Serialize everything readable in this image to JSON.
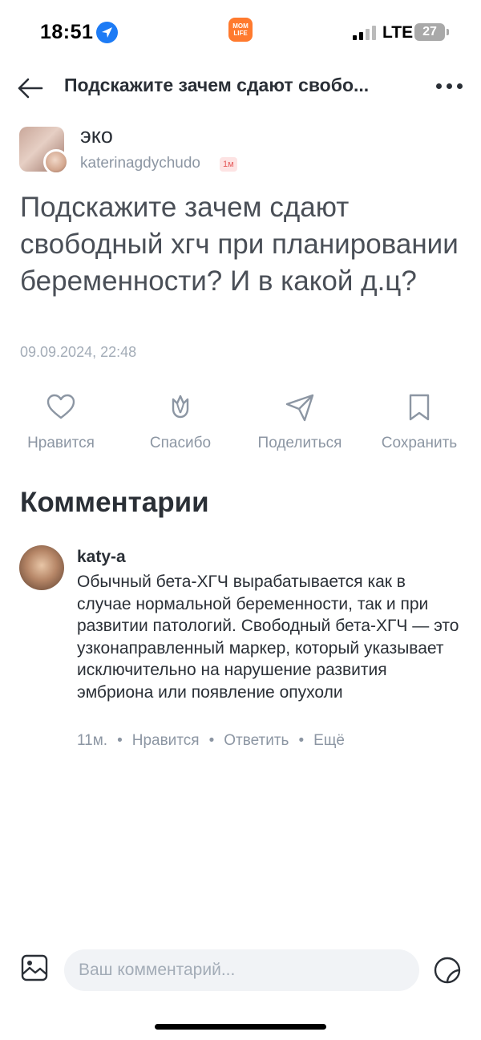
{
  "status_bar": {
    "time": "18:51",
    "network": "LTE",
    "battery": "27",
    "app_badge": "MOM LIFE",
    "location_icon": "location-arrow-icon"
  },
  "header": {
    "title": "Подскажите зачем сдают свобо...",
    "back_icon": "back-arrow-icon",
    "more_icon": "more-dots-icon"
  },
  "post": {
    "group": "эко",
    "author": "katerinagdychudo",
    "time_badge": "1м",
    "title": "Подскажите зачем сдают свободный хгч при планировании беременности? И в какой д.ц?",
    "date": "09.09.2024, 22:48"
  },
  "actions": [
    {
      "label": "Нравится",
      "icon": "heart-icon"
    },
    {
      "label": "Спасибо",
      "icon": "tulip-icon"
    },
    {
      "label": "Поделиться",
      "icon": "share-icon"
    },
    {
      "label": "Сохранить",
      "icon": "bookmark-icon"
    }
  ],
  "comments": {
    "heading": "Комментарии",
    "items": [
      {
        "author": "katy-a",
        "text": "Обычный бета-ХГЧ вырабатывается как в случае нормальной беременности, так и при развитии патологий. Свободный бета-ХГЧ — это узконаправленный маркер, который указывает исключительно на нарушение развития эмбриона или появление опухоли",
        "time": "11м.",
        "like": "Нравится",
        "reply": "Ответить",
        "more": "Ещё",
        "separator": "•"
      }
    ]
  },
  "input": {
    "placeholder": "Ваш комментарий...",
    "image_icon": "image-icon",
    "sticker_icon": "sticker-icon"
  },
  "colors": {
    "text_primary": "#2a2f36",
    "text_secondary": "#8c96a3",
    "badge_bg": "#fde3e3",
    "badge_text": "#e55b5b",
    "input_bg": "#f1f3f6",
    "location_blue": "#1d7bf5"
  }
}
